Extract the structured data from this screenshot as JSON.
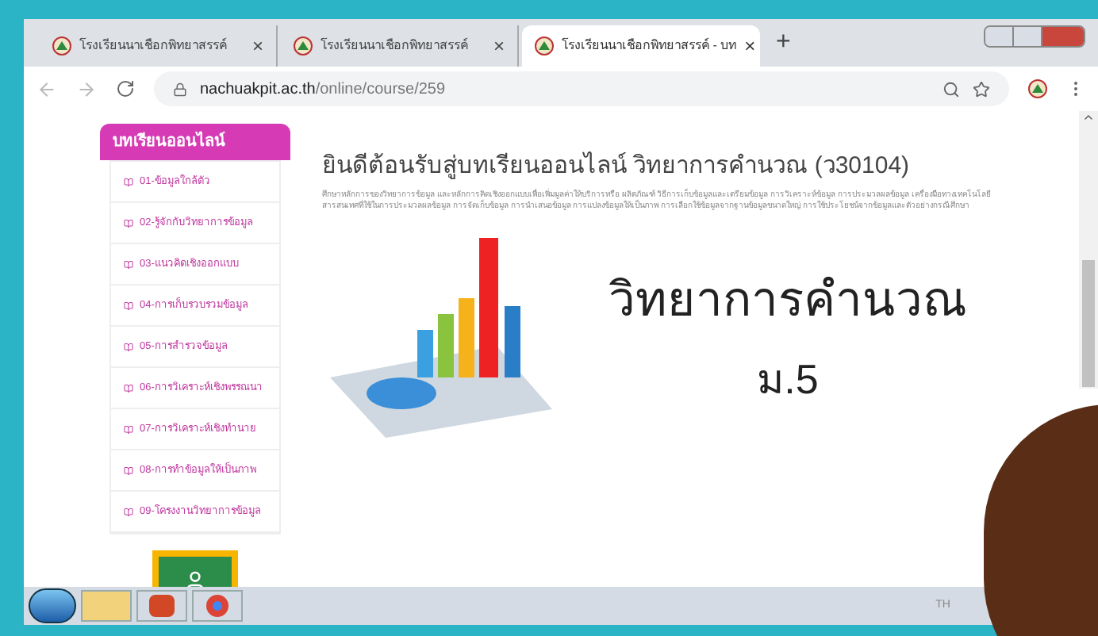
{
  "tabs": [
    {
      "label": "โรงเรียนนาเชือกพิทยาสรรค์",
      "selected": false,
      "close": "×"
    },
    {
      "label": "โรงเรียนนาเชือกพิทยาสรรค์",
      "selected": false,
      "close": "×"
    },
    {
      "label": "โรงเรียนนาเชือกพิทยาสรรค์ - บท",
      "selected": true,
      "close": "×"
    }
  ],
  "new_tab": "+",
  "address": {
    "host": "nachuakpit.ac.th",
    "path": "/online/course/259"
  },
  "sidebar": {
    "title": "บทเรียนออนไลน์",
    "items": [
      {
        "label": "01-ข้อมูลใกล้ตัว"
      },
      {
        "label": "02-รู้จักกับวิทยาการข้อมูล"
      },
      {
        "label": "03-แนวคิดเชิงออกแบบ"
      },
      {
        "label": "04-การเก็บรวบรวมข้อมูล"
      },
      {
        "label": "05-การสำรวจข้อมูล"
      },
      {
        "label": "06-การวิเคราะห์เชิงพรรณนา"
      },
      {
        "label": "07-การวิเคราะห์เชิงทำนาย"
      },
      {
        "label": "08-การทำข้อมูลให้เป็นภาพ"
      },
      {
        "label": "09-โครงงานวิทยาการข้อมูล"
      }
    ]
  },
  "main": {
    "title": "ยินดีต้อนรับสู่บทเรียนออนไลน์ วิทยาการคำนวณ (ว30104)",
    "description": "ศึกษาหลักการของวิทยาการข้อมูล และหลักการคิดเชิงออกแบบเพื่อเพิ่มมูลค่าให้บริการหรือ ผลิตภัณฑ์ วิธีการเก็บข้อมูลและเตรียมข้อมูล การวิเคราะห์ข้อมูล การประมวลผลข้อมูล เครื่องมือทางเทคโนโลยี สารสนเทศที่ใช้ในการประมวลผลข้อมูล การจัดเก็บข้อมูล การนำเสนอข้อมูล การแปลงข้อมูลให้เป็นภาพ การเลือกใช้ข้อมูลจากฐานข้อมูลขนาดใหญ่ การใช้ประโยชน์จากข้อมูลและตัวอย่างกรณีศึกษา",
    "banner_title": "วิทยาการคำนวณ",
    "banner_subtitle": "ม.5"
  },
  "taskbar": {
    "language": "TH"
  }
}
